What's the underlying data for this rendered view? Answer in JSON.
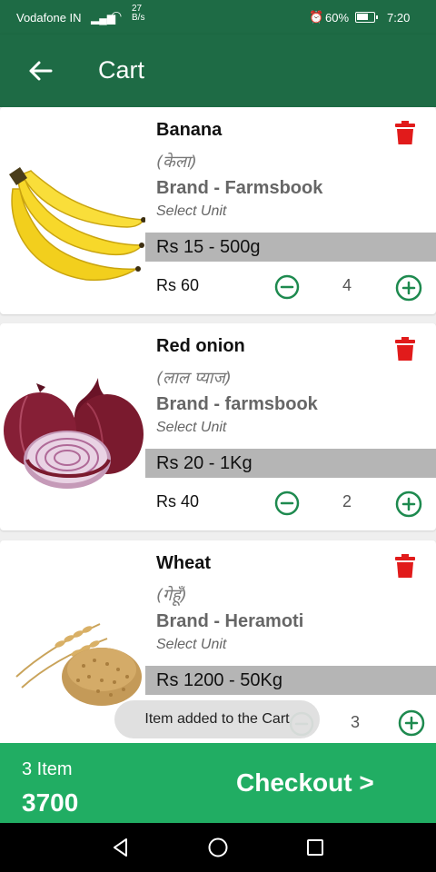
{
  "status_bar": {
    "carrier": "Vodafone IN",
    "speed_value": "27",
    "speed_unit": "B/s",
    "battery": "60%",
    "time": "7:20"
  },
  "app_bar": {
    "title": "Cart",
    "back_icon": "arrow-left-icon"
  },
  "cart_items": [
    {
      "name": "Banana",
      "local_name": "(केला)",
      "brand": "Brand - Farmsbook",
      "unit_label": "Select Unit",
      "price_unit": "Rs 15 - 500g",
      "total": "Rs 60",
      "quantity": "4",
      "image_icon": "banana-image"
    },
    {
      "name": "Red onion",
      "local_name": "(लाल प्याज)",
      "brand": "Brand - farmsbook",
      "unit_label": "Select Unit",
      "price_unit": "Rs 20 - 1Kg",
      "total": "Rs 40",
      "quantity": "2",
      "image_icon": "red-onion-image"
    },
    {
      "name": "Wheat",
      "local_name": "(गेहूँ)",
      "brand": "Brand - Heramoti",
      "unit_label": "Select Unit",
      "price_unit": "Rs 1200 - 50Kg",
      "total": "",
      "quantity": "3",
      "image_icon": "wheat-image"
    }
  ],
  "toast": {
    "message": "Item added to the Cart"
  },
  "summary": {
    "item_count": "3 Item",
    "total_amount": "3700",
    "checkout_label": "Checkout >"
  },
  "colors": {
    "app_bar": "#1e6b45",
    "checkout_bar": "#21ad63",
    "delete_red": "#e11b1b",
    "stepper_green": "#1e8a4f",
    "price_bar_gray": "#b5b5b5"
  }
}
